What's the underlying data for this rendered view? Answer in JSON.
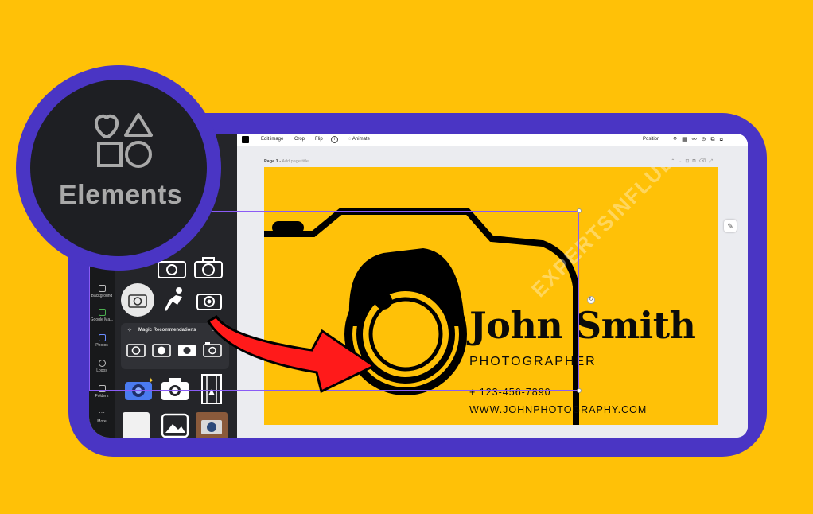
{
  "colors": {
    "background": "#FFC107",
    "frame": "#4A35C4",
    "accent_arrow": "#FF1A1A",
    "panel": "#242529"
  },
  "badge": {
    "label": "Elements",
    "icon": "elements-shapes-icon"
  },
  "sidebar": {
    "items": [
      {
        "label": "Background",
        "icon": "background-icon"
      },
      {
        "label": "Google Ma...",
        "icon": "google-maps-icon"
      },
      {
        "label": "Photos",
        "icon": "photos-icon"
      },
      {
        "label": "Logos",
        "icon": "logos-icon"
      },
      {
        "label": "Folders",
        "icon": "folder-icon"
      },
      {
        "label": "More",
        "icon": "more-icon"
      }
    ]
  },
  "elements_panel": {
    "magic_title": "Magic Recommendations",
    "see_all": "See all"
  },
  "toolbar": {
    "edit_image": "Edit image",
    "crop": "Crop",
    "flip": "Flip",
    "info": "i",
    "animate": "Animate",
    "position": "Position"
  },
  "page": {
    "label": "Page 1 -",
    "title_placeholder": "Add page title"
  },
  "card": {
    "name": "John Smith",
    "role": "PHOTOGRAPHER",
    "phone": "+ 123-456-7890",
    "website": "WWW.JOHNPHOTOGRAPHY.COM"
  },
  "watermark": "EXPERTSINFLUENCE.COM"
}
